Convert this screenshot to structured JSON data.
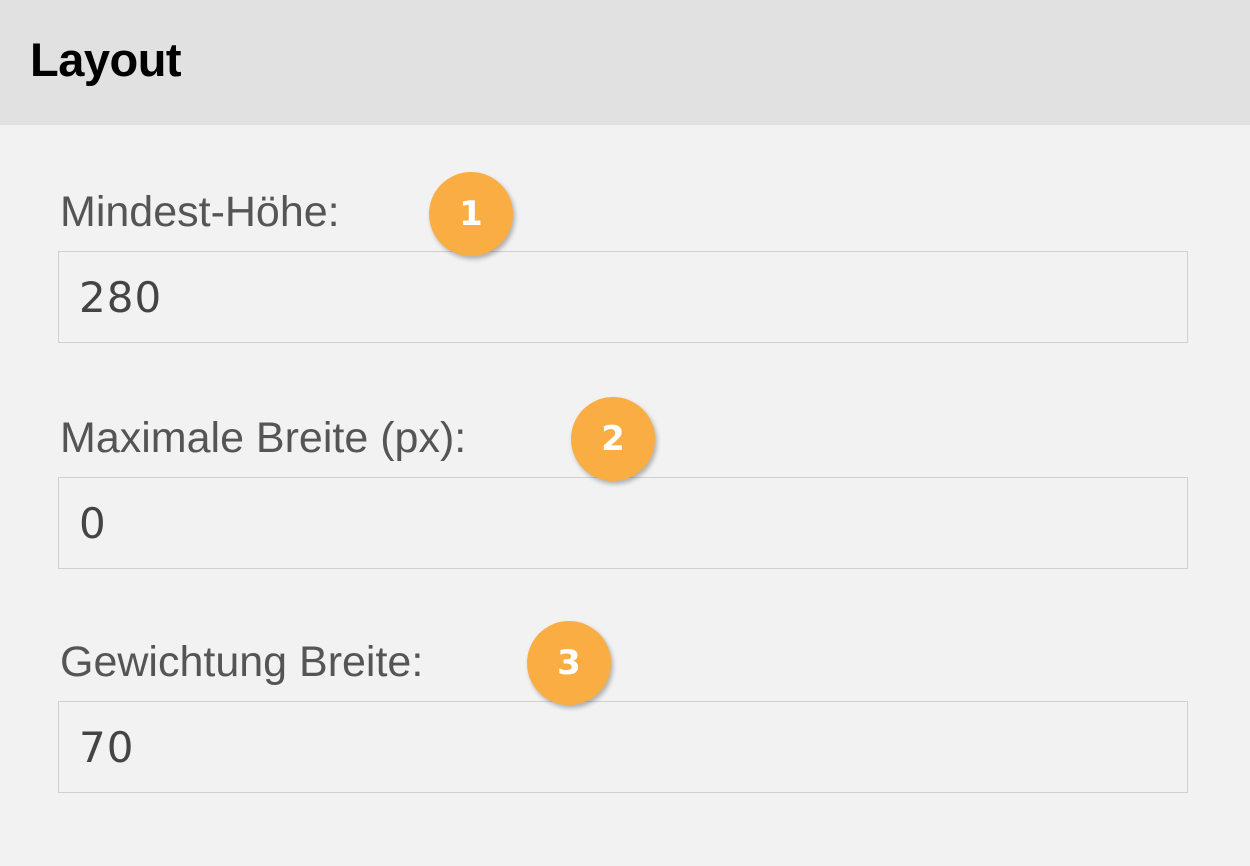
{
  "panel": {
    "title": "Layout"
  },
  "fields": [
    {
      "label": "Mindest-Höhe:",
      "value": "280",
      "callout": "1"
    },
    {
      "label": "Maximale Breite (px):",
      "value": "0",
      "callout": "2"
    },
    {
      "label": "Gewichtung Breite:",
      "value": "70",
      "callout": "3"
    }
  ],
  "colors": {
    "header_background": "#e1e1e1",
    "panel_background": "#f2f2f2",
    "callout_badge": "#f9ad42"
  }
}
